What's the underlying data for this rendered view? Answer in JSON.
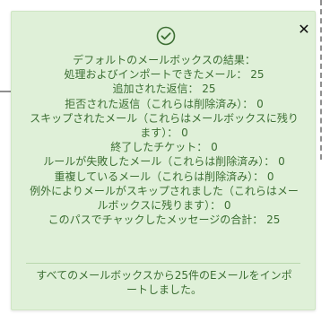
{
  "notice": {
    "close_glyph": "✕",
    "check_icon": "check-circle-icon",
    "accent_color": "#3c6e33",
    "background_color": "#dff0d8",
    "results": [
      "デフォルトのメールボックスの結果：",
      "処理およびインポートできたメール： 25",
      "追加された返信： 25",
      "拒否された返信（これらは削除済み）： 0",
      "スキップされたメール（これらはメールボックスに残ります）： 0",
      "終了したチケット： 0",
      "ルールが失敗したメール（これらは削除済み）： 0",
      "重複しているメール（これらは削除済み）： 0",
      "例外によりメールがスキップされました（これらはメールボックスに残ります）： 0",
      "このパスでチャックしたメッセージの合計： 25"
    ],
    "summary": "すべてのメールボックスから25件のEメールをインポートしました。"
  }
}
